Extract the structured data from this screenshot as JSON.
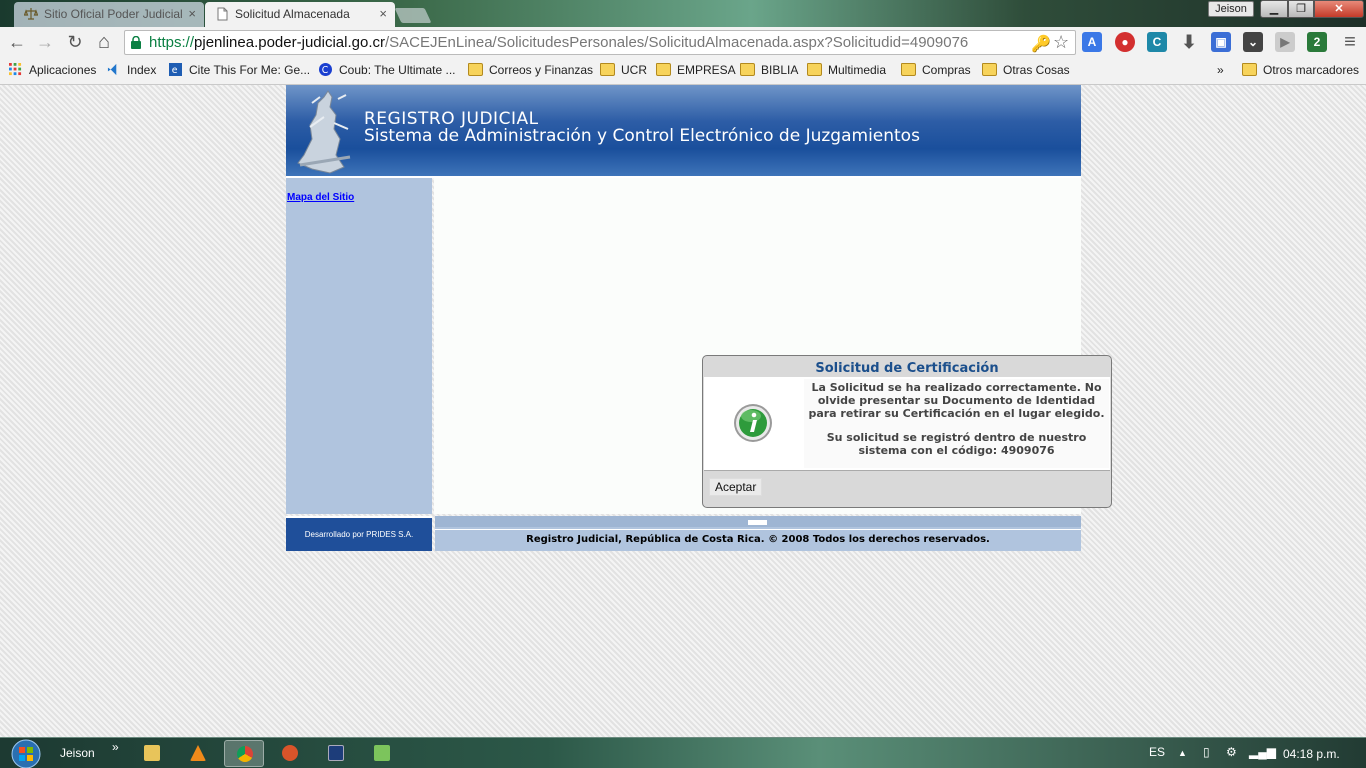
{
  "browser": {
    "tabs": [
      {
        "title": "Sitio Oficial Poder Judicial",
        "close": "×"
      },
      {
        "title": "Solicitud Almacenada",
        "close": "×"
      }
    ],
    "profile": "Jeison",
    "window_buttons": {
      "minimize": "▁",
      "maximize": "❐",
      "close": "✕"
    },
    "nav": {
      "back": "←",
      "forward": "→",
      "reload": "↻",
      "home": "⌂"
    },
    "url": {
      "scheme": "https://",
      "host": "pjenlinea.poder-judicial.go.cr",
      "path": "/SACEJEnLinea/SolicitudesPersonales/SolicitudAlmacenada.aspx?Solicitudid=4909076"
    },
    "omnibox_icons": {
      "key": "🔑",
      "star": "☆"
    },
    "bookmarks": [
      {
        "label": "Aplicaciones",
        "icon": "apps-grid-icon"
      },
      {
        "label": "Index",
        "icon": "vscode-icon"
      },
      {
        "label": "Cite This For Me: Ge...",
        "icon": "citethis-icon"
      },
      {
        "label": "Coub: The Ultimate ...",
        "icon": "coub-icon"
      },
      {
        "label": "Correos y Finanzas",
        "icon": "folder-icon"
      },
      {
        "label": "UCR",
        "icon": "folder-icon"
      },
      {
        "label": "EMPRESA",
        "icon": "folder-icon"
      },
      {
        "label": "BIBLIA",
        "icon": "folder-icon"
      },
      {
        "label": "Multimedia",
        "icon": "folder-icon"
      },
      {
        "label": "Compras",
        "icon": "folder-icon"
      },
      {
        "label": "Otras Cosas",
        "icon": "folder-icon"
      }
    ],
    "bookmarks_overflow": "»",
    "other_bookmarks": "Otros marcadores",
    "menu": "≡"
  },
  "page": {
    "banner_title": "REGISTRO JUDICIAL",
    "banner_subtitle": "Sistema de Administración y Control Electrónico de Juzgamientos",
    "sidebar_link": "Mapa del Sitio",
    "dialog": {
      "title": "Solicitud de Certificación",
      "message1": "La Solicitud se ha realizado correctamente. No olvide presentar su Documento de Identidad para retirar su Certificación en el lugar elegido.",
      "message2": "Su solicitud se registró dentro de nuestro sistema con el código: 4909076",
      "accept": "Aceptar"
    },
    "footer_left": "Desarrollado por PRIDES S.A.",
    "footer_right": "Registro Judicial, República de Costa Rica. © 2008 Todos los derechos reservados."
  },
  "taskbar": {
    "user": "Jeison",
    "overflow": "»",
    "language": "ES",
    "clock": "04:18 p.m."
  },
  "colors": {
    "banner": "#1a4f9c",
    "sidebar": "#b0c4de",
    "dialog_title": "#1b4f8c",
    "footer_dark": "#1f4f9a"
  }
}
